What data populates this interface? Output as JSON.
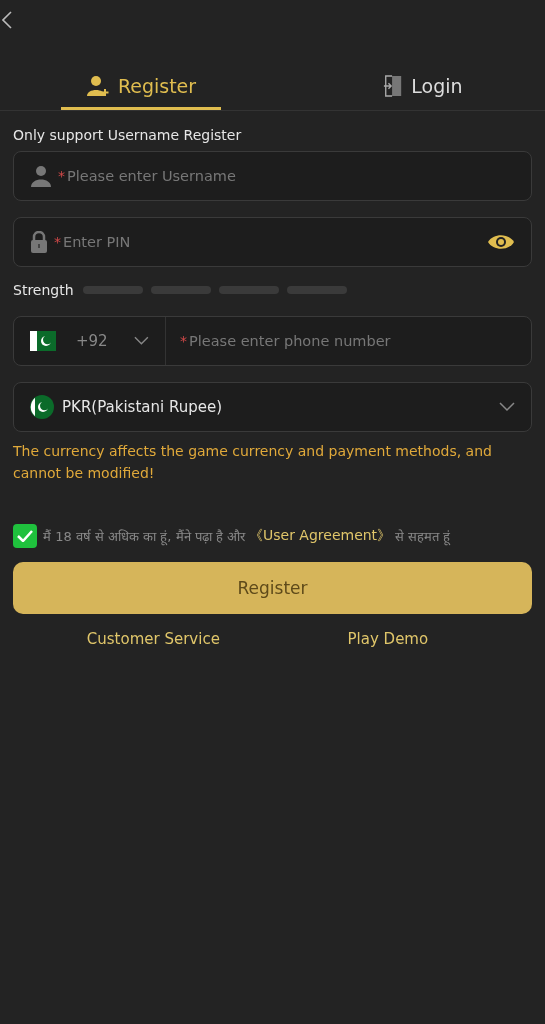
{
  "tabs": [
    {
      "label": "Register",
      "selected": true
    },
    {
      "label": "Login",
      "selected": false
    }
  ],
  "notice": "Only support Username Register",
  "username": {
    "mark": "*",
    "placeholder": "Please enter Username"
  },
  "pin": {
    "mark": "*",
    "placeholder": "Enter PIN"
  },
  "strength": {
    "label": "Strength"
  },
  "phone": {
    "code": "+92",
    "mark": "*",
    "placeholder": "Please enter phone number"
  },
  "currency": {
    "value": "PKR(Pakistani Rupee)"
  },
  "warning": "The currency affects the game currency and payment methods, and cannot be modified!",
  "agreement": {
    "checked": true,
    "text": "मैं 18 वर्ष से अधिक का हूं, मैंने पढ़ा है और",
    "link": "《User Agreement》",
    "suffix": "से सहमत हूं"
  },
  "submit": "Register",
  "links": [
    "Customer Service",
    "Play Demo"
  ]
}
